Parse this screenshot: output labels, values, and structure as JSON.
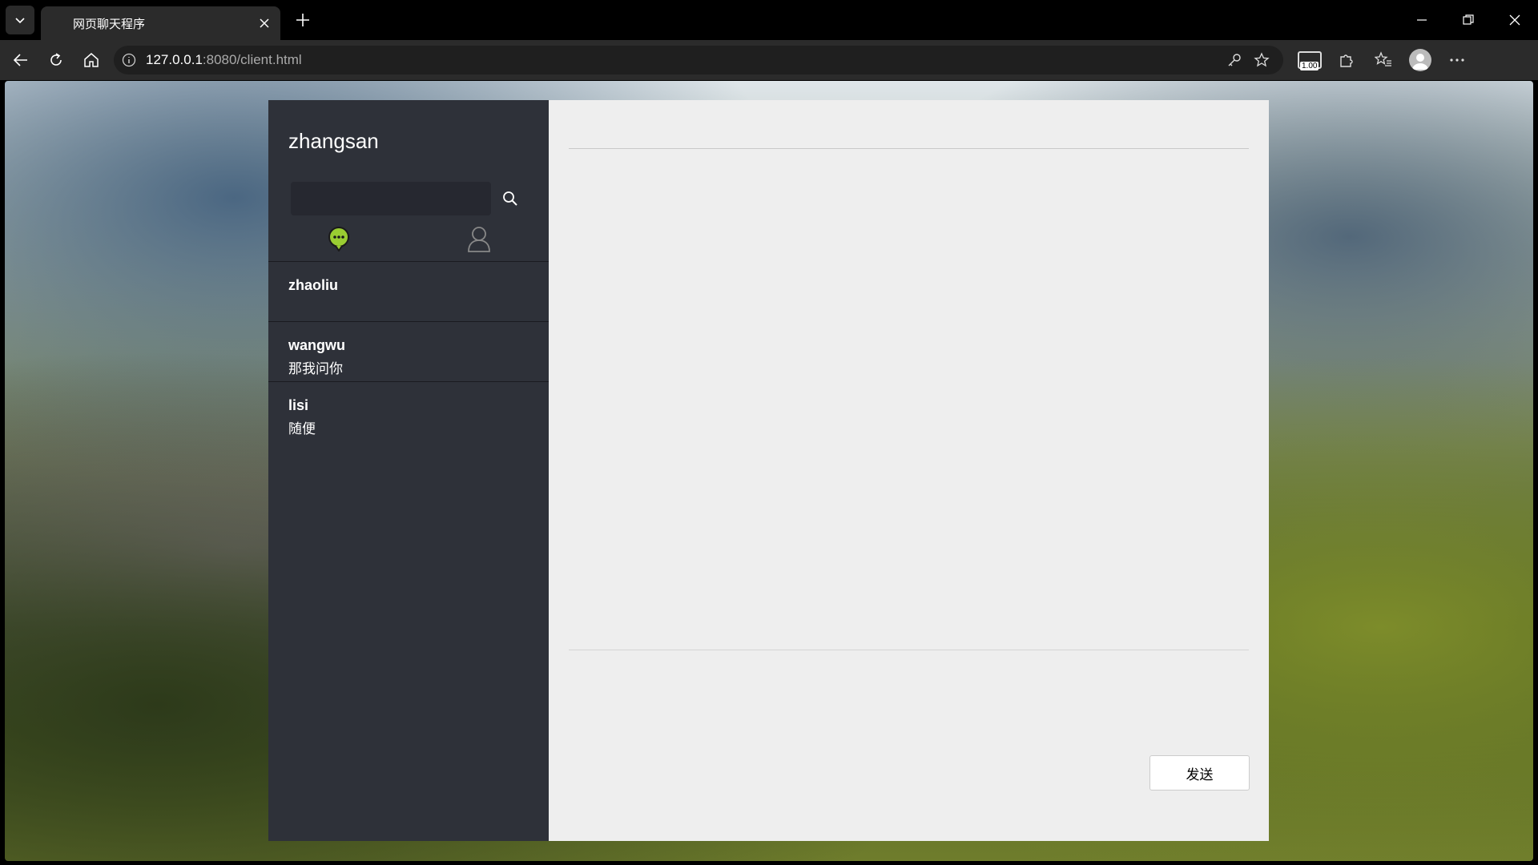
{
  "browser": {
    "tab_title": "网页聊天程序",
    "url_host": "127.0.0.1",
    "url_rest": ":8080/client.html",
    "extension_badge": "1.00"
  },
  "app": {
    "current_user": "zhangsan",
    "search": {
      "value": "",
      "placeholder": ""
    },
    "accent_color": "#9acd32",
    "conversations": [
      {
        "name": "zhaoliu",
        "last_message": ""
      },
      {
        "name": "wangwu",
        "last_message": "那我问你"
      },
      {
        "name": "lisi",
        "last_message": "随便"
      }
    ],
    "main_title": "",
    "send_label": "发送"
  }
}
